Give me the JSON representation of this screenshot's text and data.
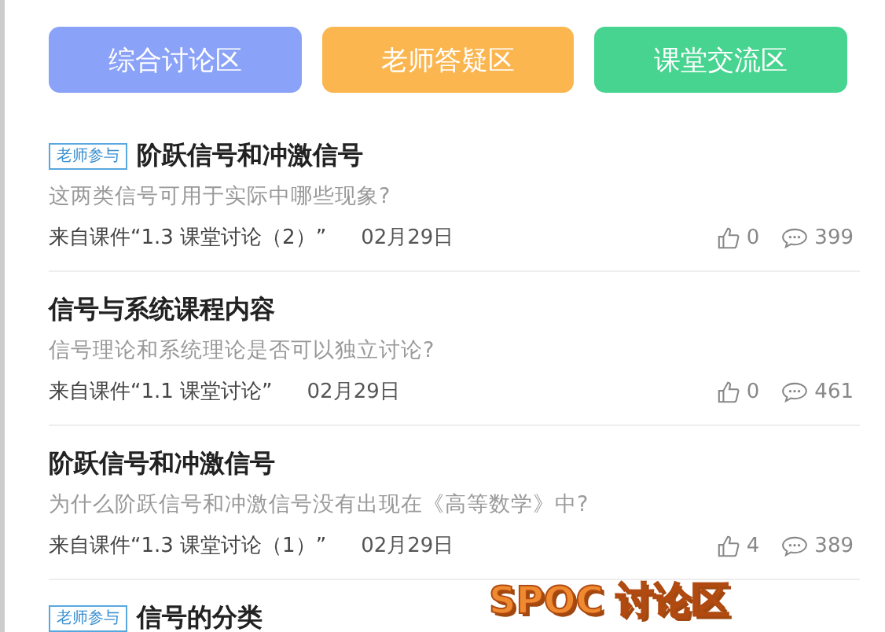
{
  "categories": [
    {
      "label": "综合讨论区",
      "color": "#8aa2f7"
    },
    {
      "label": "老师答疑区",
      "color": "#fbb64f"
    },
    {
      "label": "课堂交流区",
      "color": "#47d490"
    }
  ],
  "posts": [
    {
      "teacher_badge": "老师参与",
      "title": "阶跃信号和冲激信号",
      "summary": "这两类信号可用于实际中哪些现象?",
      "source": "来自课件“1.3 课堂讨论（2）”",
      "date": "02月29日",
      "likes": "0",
      "comments": "399"
    },
    {
      "title": "信号与系统课程内容",
      "summary": "信号理论和系统理论是否可以独立讨论?",
      "source": "来自课件“1.1 课堂讨论”",
      "date": "02月29日",
      "likes": "0",
      "comments": "461"
    },
    {
      "title": "阶跃信号和冲激信号",
      "summary": "为什么阶跃信号和冲激信号没有出现在《高等数学》中?",
      "source": "来自课件“1.3 课堂讨论（1）”",
      "date": "02月29日",
      "likes": "4",
      "comments": "389"
    },
    {
      "teacher_badge": "老师参与",
      "title": "信号的分类"
    }
  ],
  "caption": "SPOC 讨论区"
}
